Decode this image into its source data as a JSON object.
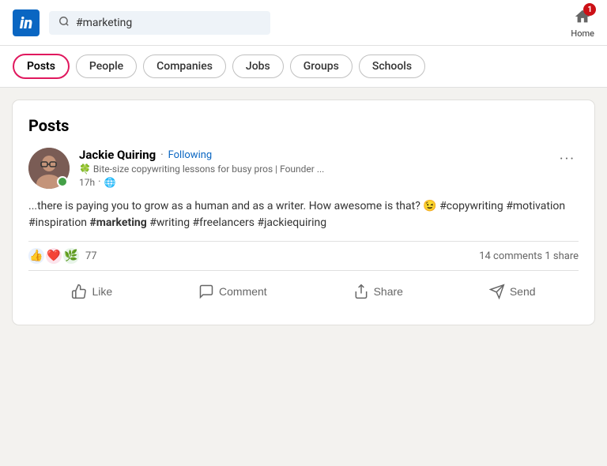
{
  "header": {
    "logo_text": "in",
    "search_value": "#marketing",
    "search_placeholder": "Search",
    "home_label": "Home",
    "notification_count": "1"
  },
  "filter_tabs": {
    "items": [
      {
        "id": "posts",
        "label": "Posts",
        "active": true
      },
      {
        "id": "people",
        "label": "People",
        "active": false
      },
      {
        "id": "companies",
        "label": "Companies",
        "active": false
      },
      {
        "id": "jobs",
        "label": "Jobs",
        "active": false
      },
      {
        "id": "groups",
        "label": "Groups",
        "active": false
      },
      {
        "id": "schools",
        "label": "Schools",
        "active": false
      }
    ]
  },
  "section_title": "Posts",
  "post": {
    "author_name": "Jackie Quiring",
    "following_label": "Following",
    "subtitle": "🍀 Bite-size copywriting lessons for busy pros | Founder ...",
    "time": "17h",
    "visibility": "🌐",
    "body_text": "...there is paying you to grow as a human and as a writer. How awesome is that? 😉 #copywriting #motivation #inspiration #marketing #writing #freelancers #jackiequiring",
    "body_bold": "#marketing",
    "reactions": {
      "emojis": [
        "👍",
        "❤️",
        "🌿"
      ],
      "count": "77",
      "comments": "14 comments",
      "shares": "1 share"
    },
    "actions": {
      "like": "Like",
      "comment": "Comment",
      "share": "Share",
      "send": "Send"
    }
  }
}
